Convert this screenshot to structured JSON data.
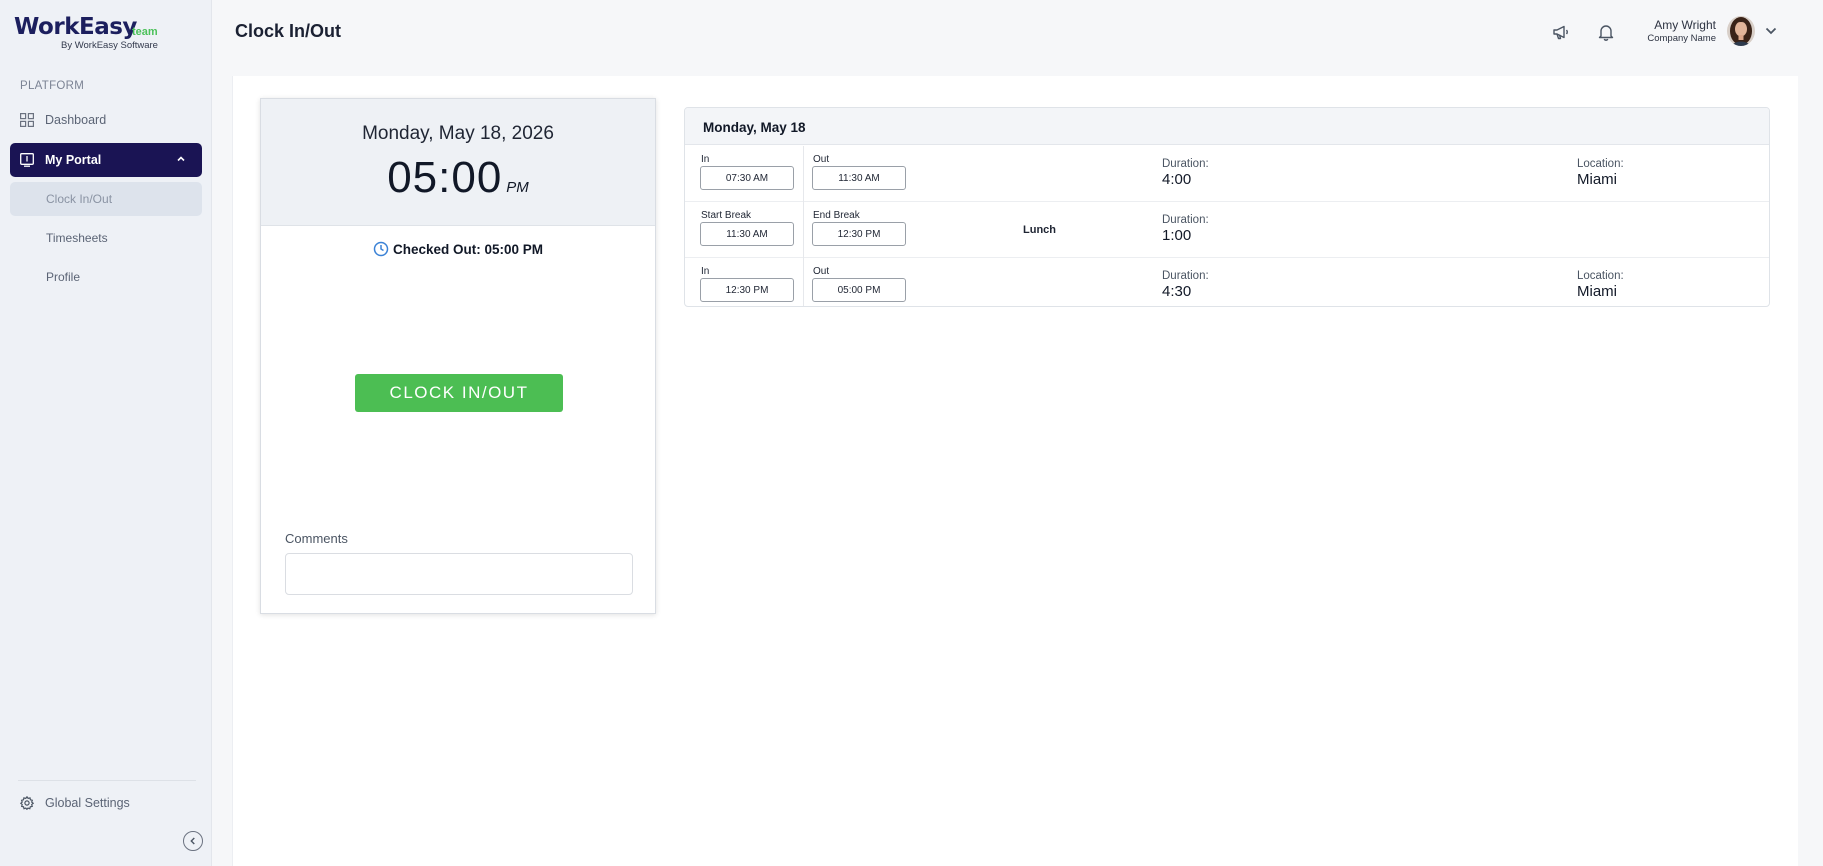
{
  "brand": {
    "name": "WorkEasy",
    "suffix": "team",
    "byline": "By WorkEasy Software",
    "accent_color": "#1a1454",
    "green": "#4cbe53"
  },
  "sidebar": {
    "section_label": "PLATFORM",
    "dashboard": "Dashboard",
    "portal": "My Portal",
    "portal_items": [
      "Clock In/Out",
      "Timesheets",
      "Profile"
    ],
    "settings": "Global Settings"
  },
  "header": {
    "title": "Clock In/Out",
    "user_name": "Amy Wright",
    "company": "Company Name"
  },
  "clock": {
    "date": "Monday, May 18, 2026",
    "time": "05:00",
    "ampm": "PM",
    "status": "Checked Out: 05:00 PM",
    "button_label": "CLOCK IN/OUT",
    "comments_label": "Comments",
    "comments_value": ""
  },
  "day": {
    "title": "Monday, May 18",
    "entries": [
      {
        "label_a": "In",
        "value_a": "07:30 AM",
        "label_b": "Out",
        "value_b": "11:30 AM",
        "break_name": "",
        "duration_label": "Duration:",
        "duration": "4:00",
        "location_label": "Location:",
        "location": "Miami"
      },
      {
        "label_a": "Start Break",
        "value_a": "11:30 AM",
        "label_b": "End Break",
        "value_b": "12:30 PM",
        "break_name": "Lunch",
        "duration_label": "Duration:",
        "duration": "1:00",
        "location_label": "",
        "location": ""
      },
      {
        "label_a": "In",
        "value_a": "12:30 PM",
        "label_b": "Out",
        "value_b": "05:00 PM",
        "break_name": "",
        "duration_label": "Duration:",
        "duration": "4:30",
        "location_label": "Location:",
        "location": "Miami"
      }
    ]
  }
}
